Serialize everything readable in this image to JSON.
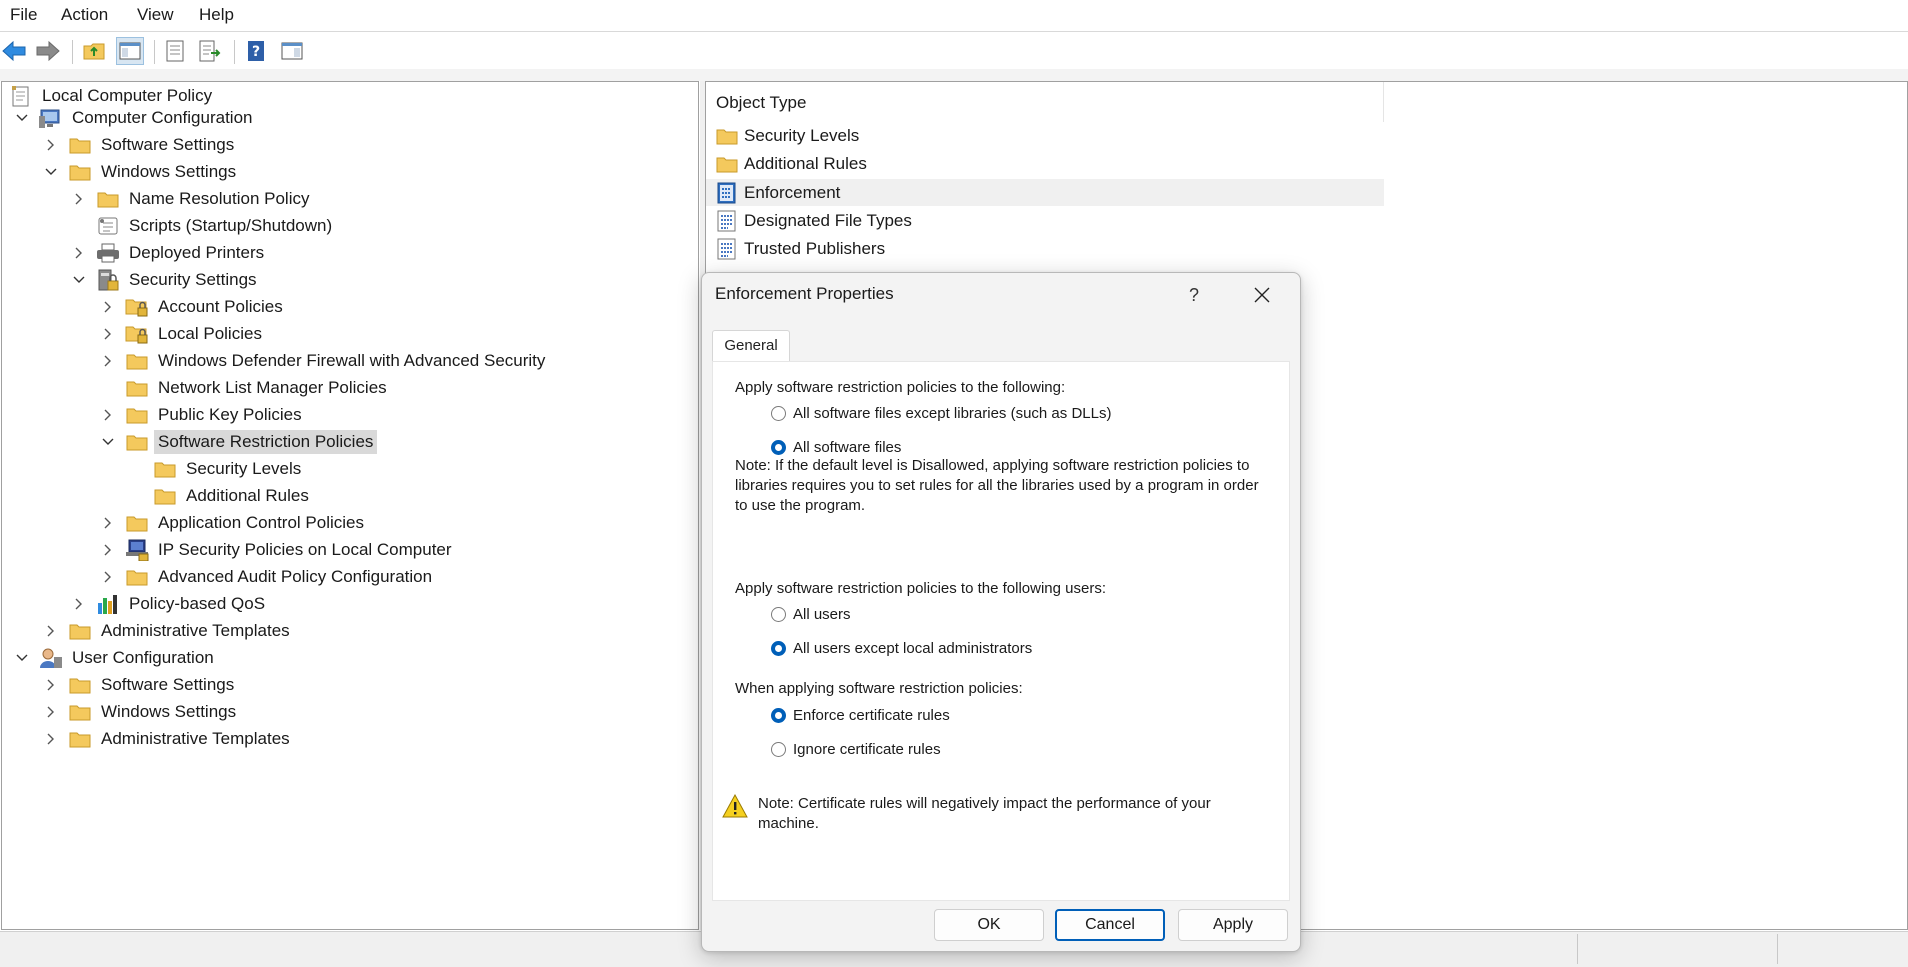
{
  "menu": [
    "File",
    "Action",
    "View",
    "Help"
  ],
  "tree": {
    "root": "Local Computer Policy",
    "computer_configuration": "Computer Configuration",
    "software_settings": "Software Settings",
    "windows_settings": "Windows Settings",
    "name_resolution_policy": "Name Resolution Policy",
    "scripts": "Scripts (Startup/Shutdown)",
    "deployed_printers": "Deployed Printers",
    "security_settings": "Security Settings",
    "account_policies": "Account Policies",
    "local_policies": "Local Policies",
    "firewall": "Windows Defender Firewall with Advanced Security",
    "network_list": "Network List Manager Policies",
    "public_key": "Public Key Policies",
    "srp": "Software Restriction Policies",
    "security_levels": "Security Levels",
    "additional_rules": "Additional Rules",
    "app_control": "Application Control Policies",
    "ip_security": "IP Security Policies on Local Computer",
    "audit_policy": "Advanced Audit Policy Configuration",
    "qos": "Policy-based QoS",
    "admin_templates": "Administrative Templates",
    "user_configuration": "User Configuration",
    "user_software_settings": "Software Settings",
    "user_windows_settings": "Windows Settings",
    "user_admin_templates": "Administrative Templates"
  },
  "list": {
    "column_header": "Object Type",
    "items": [
      "Security Levels",
      "Additional Rules",
      "Enforcement",
      "Designated File Types",
      "Trusted Publishers"
    ]
  },
  "dialog": {
    "title": "Enforcement Properties",
    "help_label": "?",
    "tab_general": "General",
    "apply_to_label": "Apply software restriction policies to the following:",
    "opt_except_libraries": "All software files except libraries (such as DLLs)",
    "opt_all_files": "All software files",
    "note1": "Note:  If the default level is Disallowed, applying software restriction policies to libraries requires you to set rules for all the libraries used by a program in order to use the program.",
    "users_label": "Apply software restriction policies to the following users:",
    "opt_all_users": "All users",
    "opt_except_admins": "All users except local administrators",
    "cert_label": "When applying software restriction policies:",
    "opt_enforce_cert": "Enforce certificate rules",
    "opt_ignore_cert": "Ignore certificate rules",
    "note2": "Note:  Certificate rules will negatively impact the performance of your machine.",
    "ok": "OK",
    "cancel": "Cancel",
    "apply": "Apply"
  },
  "colors": {
    "accent": "#005fb8",
    "folder": "#f4c95d",
    "selection": "#d9d9d9"
  }
}
